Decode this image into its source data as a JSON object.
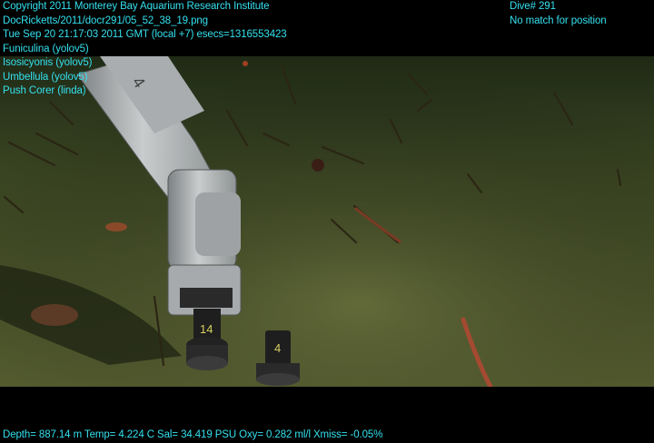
{
  "overlay": {
    "top_left": [
      "Copyright 2011 Monterey Bay Aquarium Research Institute",
      "DocRicketts/2011/docr291/05_52_38_19.png",
      "Tue Sep 20 21:17:03 2011 GMT (local +7)  esecs=1316553423",
      "Funiculina (yolov5)",
      "Isosicyonis (yolov5)",
      "Umbellula (yolov5)",
      "Push Corer (linda)"
    ],
    "top_right": [
      "Dive# 291",
      "No match for position"
    ],
    "bottom": "Depth= 887.14 m  Temp= 4.224 C  Sal= 34.419 PSU  Oxy= 0.282 ml/l  Xmiss= -0.05%"
  },
  "scene": {
    "corer_labels": [
      "14",
      "4"
    ],
    "colors": {
      "text": "#34e0ee",
      "seafloor": "#3f4a22",
      "arm": "#b9bcbe"
    }
  }
}
